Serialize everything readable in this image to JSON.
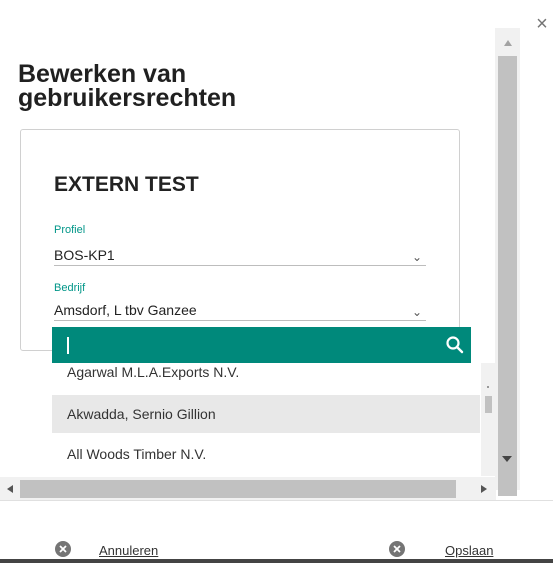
{
  "dialog": {
    "title": "Bewerken van gebruikersrechten",
    "close_label": "×"
  },
  "card": {
    "heading": "EXTERN TEST",
    "profiel": {
      "label": "Profiel",
      "value": "BOS-KP1"
    },
    "bedrijf": {
      "label": "Bedrijf",
      "value": "Amsdorf, L tbv Ganzee"
    }
  },
  "dropdown": {
    "search_value": "",
    "items": [
      {
        "label": "Agarwal M.L.A.Exports N.V.",
        "highlighted": false
      },
      {
        "label": "Akwadda, Sernio Gillion",
        "highlighted": true
      },
      {
        "label": "All Woods Timber N.V.",
        "highlighted": false
      }
    ]
  },
  "footer": {
    "cancel_label": "Annuleren",
    "save_label": "Opslaan"
  },
  "colors": {
    "accent": "#00897b",
    "label_teal": "#009688",
    "highlight_row": "#e8e8e8"
  },
  "icons": {
    "close": "close-icon",
    "search": "search-icon",
    "chevron": "chevron-down-icon",
    "cancel": "cancel-circle-icon",
    "save": "save-circle-icon"
  }
}
